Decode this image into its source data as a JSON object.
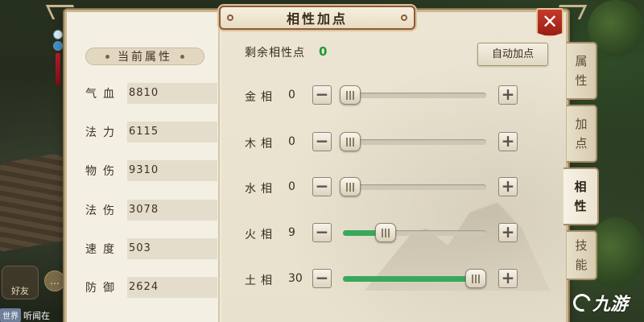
{
  "dialog": {
    "title": "相性加点",
    "close_label": "✕"
  },
  "left": {
    "header": "当前属性",
    "attributes": [
      {
        "label": "气血",
        "value": "8810"
      },
      {
        "label": "法力",
        "value": "6115"
      },
      {
        "label": "物伤",
        "value": "9310"
      },
      {
        "label": "法伤",
        "value": "3078"
      },
      {
        "label": "速度",
        "value": "503"
      },
      {
        "label": "防御",
        "value": "2624"
      }
    ]
  },
  "right": {
    "remaining_label": "剩余相性点",
    "remaining_value": "0",
    "auto_button": "自动加点",
    "phases": [
      {
        "label": "金相",
        "value": "0",
        "level": 0.0
      },
      {
        "label": "木相",
        "value": "0",
        "level": 0.0
      },
      {
        "label": "水相",
        "value": "0",
        "level": 0.0
      },
      {
        "label": "火相",
        "value": "9",
        "level": 0.3
      },
      {
        "label": "土相",
        "value": "30",
        "level": 1.0
      }
    ],
    "minus_label": "−",
    "plus_label": "+"
  },
  "side_tabs": [
    {
      "chars": [
        "属",
        "性"
      ],
      "active": false
    },
    {
      "chars": [
        "加",
        "点"
      ],
      "active": false
    },
    {
      "chars": [
        "相",
        "性"
      ],
      "active": true
    },
    {
      "chars": [
        "技",
        "能"
      ],
      "active": false
    }
  ],
  "hud": {
    "friends_label": "好友",
    "chat_icon_label": "…",
    "chat_tag": "世界",
    "chat_text": "听闻在"
  },
  "watermark": {
    "text": "九游"
  },
  "colors": {
    "accent_green": "#3aa85a",
    "remaining_green": "#1e9a37",
    "close_red": "#b8281f"
  }
}
